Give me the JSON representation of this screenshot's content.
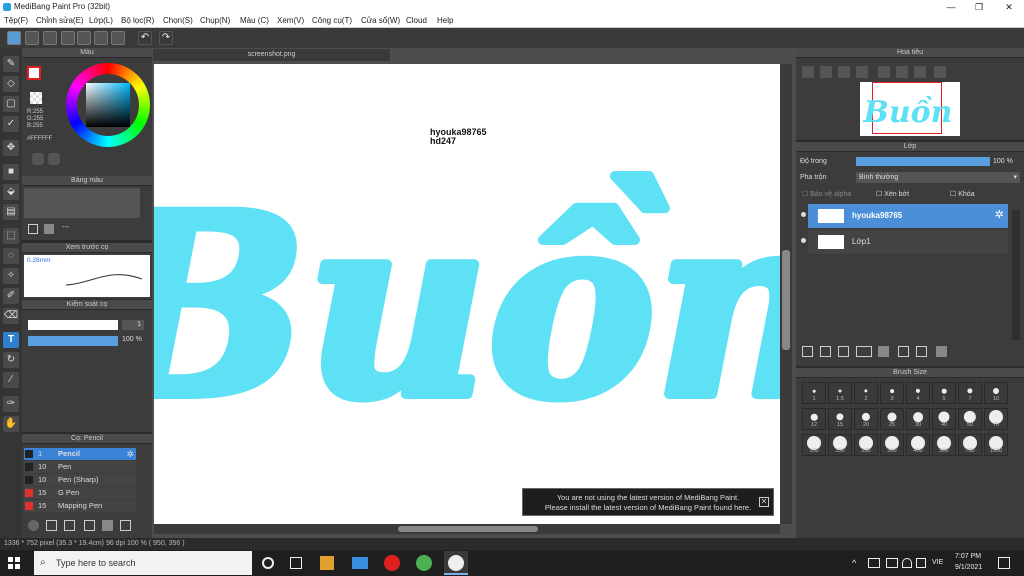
{
  "window": {
    "title": "MediBang Paint Pro (32bit)"
  },
  "menu": [
    "Tệp(F)",
    "Chỉnh sửa(E)",
    "Lớp(L)",
    "Bộ lọc(R)",
    "Chọn(S)",
    "Chụp(N)",
    "Màu (C)",
    "Xem(V)",
    "Công cụ(T)",
    "Cửa sổ(W)",
    "Cloud",
    "Help"
  ],
  "color_panel": {
    "title": "Màu",
    "r": "R:255",
    "g": "G:255",
    "b": "B:255",
    "hex": "#FFFFFF"
  },
  "palette_panel": {
    "title": "Bảng màu",
    "dash": "---"
  },
  "brush_preview": {
    "title": "Xem trước cọ",
    "size": "0.28mm"
  },
  "brush_control": {
    "title": "Kiểm soát cọ",
    "size_value": "1",
    "opacity": "100 %"
  },
  "brush_list": {
    "title": "Cọ: Pencil",
    "items": [
      {
        "num": "1",
        "name": "Pencil",
        "color": "#222222",
        "selected": true
      },
      {
        "num": "10",
        "name": "Pen",
        "color": "#222222",
        "selected": false
      },
      {
        "num": "10",
        "name": "Pen (Sharp)",
        "color": "#222222",
        "selected": false
      },
      {
        "num": "15",
        "name": "G Pen",
        "color": "#e03030",
        "selected": false
      },
      {
        "num": "15",
        "name": "Mapping Pen",
        "color": "#e03030",
        "selected": false
      }
    ]
  },
  "canvas": {
    "tab": "screenshot.png",
    "watermark_line1": "hyouka98765",
    "watermark_line2": "hd247",
    "art_text": "Buồn",
    "art_color": "#5ee0f5"
  },
  "notice": {
    "line1": "You are not using the latest version of MediBang Paint.",
    "line2": "Please install the latest version of MediBang Paint found here."
  },
  "status": "1336 * 752 pixel  (35.3 * 19.4cm)  96 dpi  100 %  ( 950, 356 )",
  "navigator": {
    "title": "Hoa tiêu"
  },
  "layer_panel": {
    "title": "Lớp",
    "opacity_label": "Độ trong",
    "opacity_value": "100 %",
    "blend_label": "Pha trộn",
    "blend_value": "Bình thường",
    "opt1": "Bảo vệ alpha",
    "opt2": "Xén bớt",
    "opt3": "Khóa",
    "layers": [
      {
        "name": "hyouka98765",
        "selected": true
      },
      {
        "name": "Lớp1",
        "selected": false
      }
    ]
  },
  "brush_size": {
    "title": "Brush Size",
    "sizes": [
      "1",
      "1.5",
      "2",
      "3",
      "4",
      "5",
      "7",
      "10",
      "12",
      "15",
      "20",
      "25",
      "30",
      "40",
      "50",
      "70",
      "100",
      "150",
      "200",
      "300",
      "400",
      "500",
      "700",
      "1000"
    ]
  },
  "taskbar": {
    "search": "Type here to search",
    "lang": "VIE",
    "time": "7:07 PM",
    "date": "9/1/2021"
  }
}
